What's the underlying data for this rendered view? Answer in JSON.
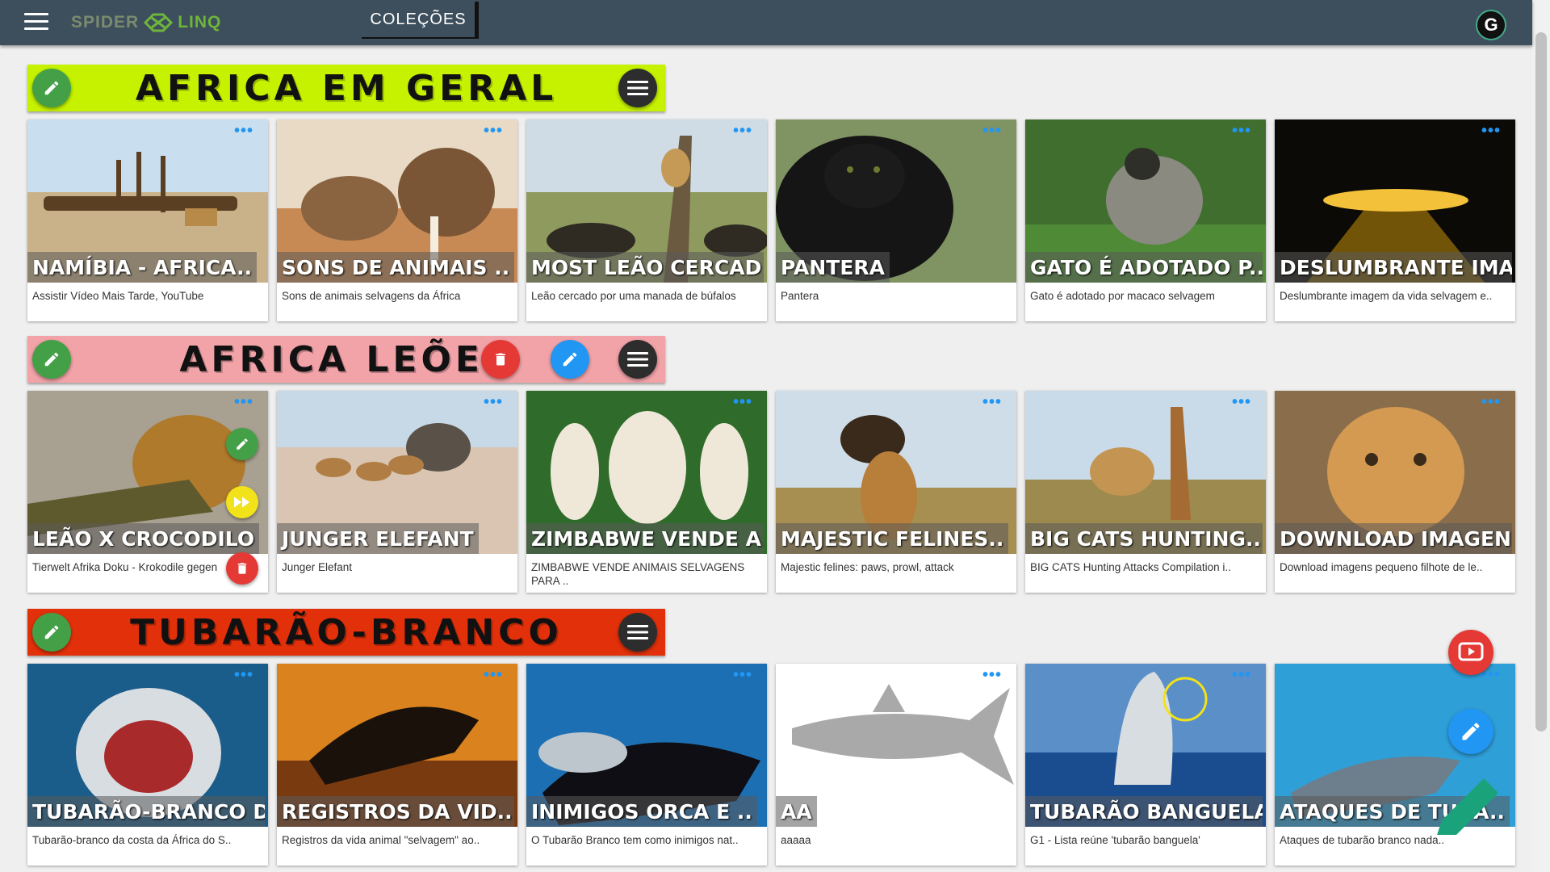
{
  "header": {
    "logo_spider": "SPIDER",
    "logo_linq": "LINQ",
    "nav_tab": "COLEÇÕES",
    "account_initial": "G"
  },
  "sections": [
    {
      "title": "AFRICA EM GERAL",
      "color": "#c6f200",
      "cards": [
        {
          "title": "NAMÍBIA - AFRICA..",
          "desc": "Assistir Vídeo Mais Tarde, YouTube"
        },
        {
          "title": "SONS DE ANIMAIS ..",
          "desc": "Sons de animais selvagens da África"
        },
        {
          "title": "MOST LEÃO CERCAD..",
          "desc": "Leão cercado por uma manada de búfalos"
        },
        {
          "title": "PANTERA",
          "desc": "Pantera"
        },
        {
          "title": "GATO É ADOTADO P..",
          "desc": "Gato é adotado por macaco selvagem"
        },
        {
          "title": "DESLUMBRANTE IMA..",
          "desc": "Deslumbrante imagem da vida selvagem e.."
        }
      ]
    },
    {
      "title": "AFRICA LEÕES",
      "color": "#f2a3a8",
      "cards": [
        {
          "title": "LEÃO X CROCODILO",
          "desc": "Tierwelt Afrika Doku - Krokodile gegen"
        },
        {
          "title": "JUNGER ELEFANT",
          "desc": "Junger Elefant"
        },
        {
          "title": "ZIMBABWE VENDE A..",
          "desc": "ZIMBABWE VENDE ANIMAIS SELVAGENS PARA .."
        },
        {
          "title": "MAJESTIC FELINES..",
          "desc": "Majestic felines: paws, prowl, attack"
        },
        {
          "title": "BIG CATS HUNTING..",
          "desc": "BIG CATS Hunting Attacks Compilation i.."
        },
        {
          "title": "DOWNLOAD IMAGENS..",
          "desc": "Download imagens pequeno filhote de le.."
        }
      ]
    },
    {
      "title": "TUBARÃO-BRANCO",
      "color": "#e2300a",
      "cards": [
        {
          "title": "TUBARÃO-BRANCO D..",
          "desc": "Tubarão-branco da costa da África do S.."
        },
        {
          "title": "REGISTROS DA VID..",
          "desc": "Registros da vida animal \"selvagem\" ao.."
        },
        {
          "title": "INIMIGOS ORCA E ..",
          "desc": "O Tubarão Branco tem como inimigos nat.."
        },
        {
          "title": "AA",
          "desc": "aaaaa"
        },
        {
          "title": "TUBARÃO BANGUELA",
          "desc": "G1 - Lista reúne 'tubarão banguela'"
        },
        {
          "title": "ATAQUES DE TUBA..",
          "desc": "Ataques de tubarão branco nada.."
        }
      ]
    }
  ],
  "icons": {
    "menu": "hamburger-icon",
    "edit": "pencil-icon",
    "options": "more-horizontal-icon",
    "delete": "trash-icon",
    "video": "youtube-icon",
    "fast_forward": "fast-forward-icon"
  }
}
